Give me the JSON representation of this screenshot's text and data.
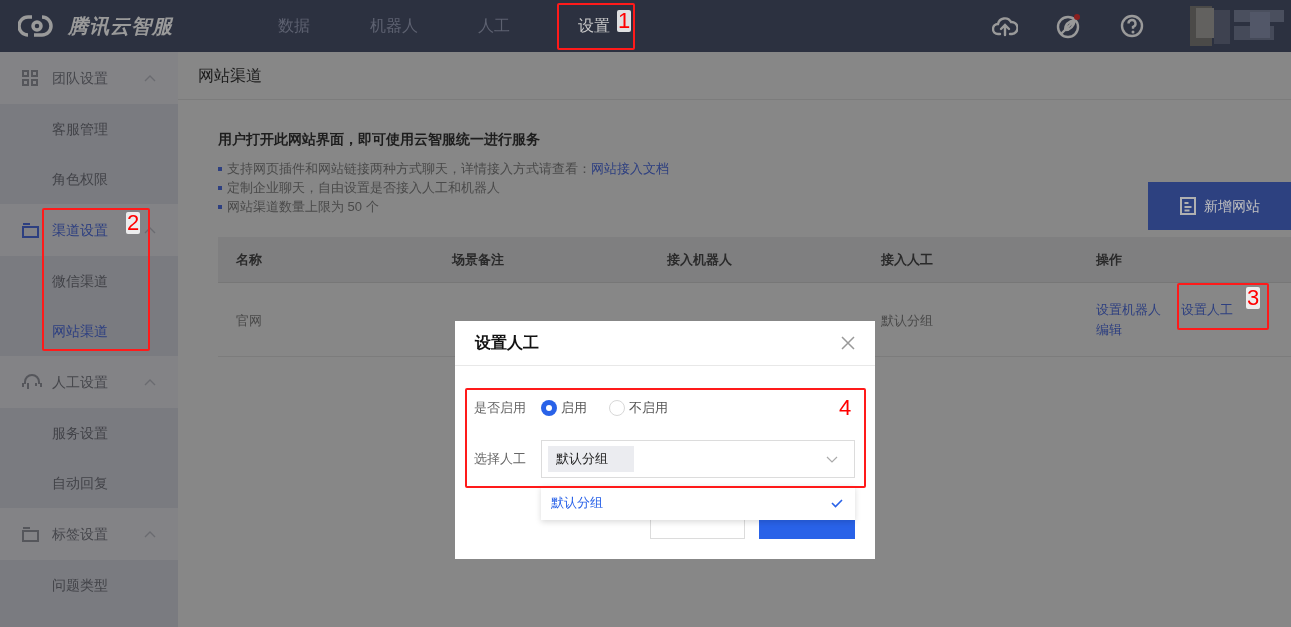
{
  "header": {
    "logo_text": "腾讯云智服",
    "nav": [
      {
        "label": "数据",
        "selected": false
      },
      {
        "label": "机器人",
        "selected": false
      },
      {
        "label": "人工",
        "selected": false
      },
      {
        "label": "设置",
        "selected": true
      }
    ]
  },
  "sidebar": {
    "groups": [
      {
        "label": "团队设置",
        "expanded": true,
        "selected": false,
        "children": [
          {
            "label": "客服管理",
            "selected": false
          },
          {
            "label": "角色权限",
            "selected": false
          }
        ]
      },
      {
        "label": "渠道设置",
        "expanded": true,
        "selected": true,
        "children": [
          {
            "label": "微信渠道",
            "selected": false
          },
          {
            "label": "网站渠道",
            "selected": true
          }
        ]
      },
      {
        "label": "人工设置",
        "expanded": true,
        "selected": false,
        "children": [
          {
            "label": "服务设置",
            "selected": false
          },
          {
            "label": "自动回复",
            "selected": false
          }
        ]
      },
      {
        "label": "标签设置",
        "expanded": true,
        "selected": false,
        "children": [
          {
            "label": "问题类型",
            "selected": false
          }
        ]
      }
    ]
  },
  "page": {
    "title": "网站渠道",
    "heading": "用户打开此网站界面，即可使用云智服统一进行服务",
    "bullets": [
      {
        "text": "支持网页插件和网站链接两种方式聊天，详情接入方式请查看：",
        "link": "网站接入文档"
      },
      {
        "text": "定制企业聊天，自由设置是否接入人工和机器人"
      },
      {
        "text": "网站渠道数量上限为 50 个"
      }
    ],
    "add_button": "新增网站"
  },
  "table": {
    "columns": [
      "名称",
      "场景备注",
      "接入机器人",
      "接入人工",
      "操作"
    ],
    "rows": [
      {
        "name": "官网",
        "agent": "默认分组",
        "actions": [
          "设置机器人",
          "设置人工",
          "编辑"
        ]
      }
    ]
  },
  "modal": {
    "title": "设置人工",
    "enable_label": "是否启用",
    "options": [
      {
        "label": "启用",
        "selected": true
      },
      {
        "label": "不启用",
        "selected": false
      }
    ],
    "select_label": "选择人工",
    "tags": [
      "默认分组"
    ],
    "dropdown": [
      {
        "label": "默认分组",
        "selected": true
      }
    ],
    "buttons": [
      {
        "kind": "secondary"
      },
      {
        "kind": "primary"
      }
    ]
  },
  "annotations": [
    {
      "label": "1"
    },
    {
      "label": "2"
    },
    {
      "label": "3"
    },
    {
      "label": "4"
    }
  ]
}
